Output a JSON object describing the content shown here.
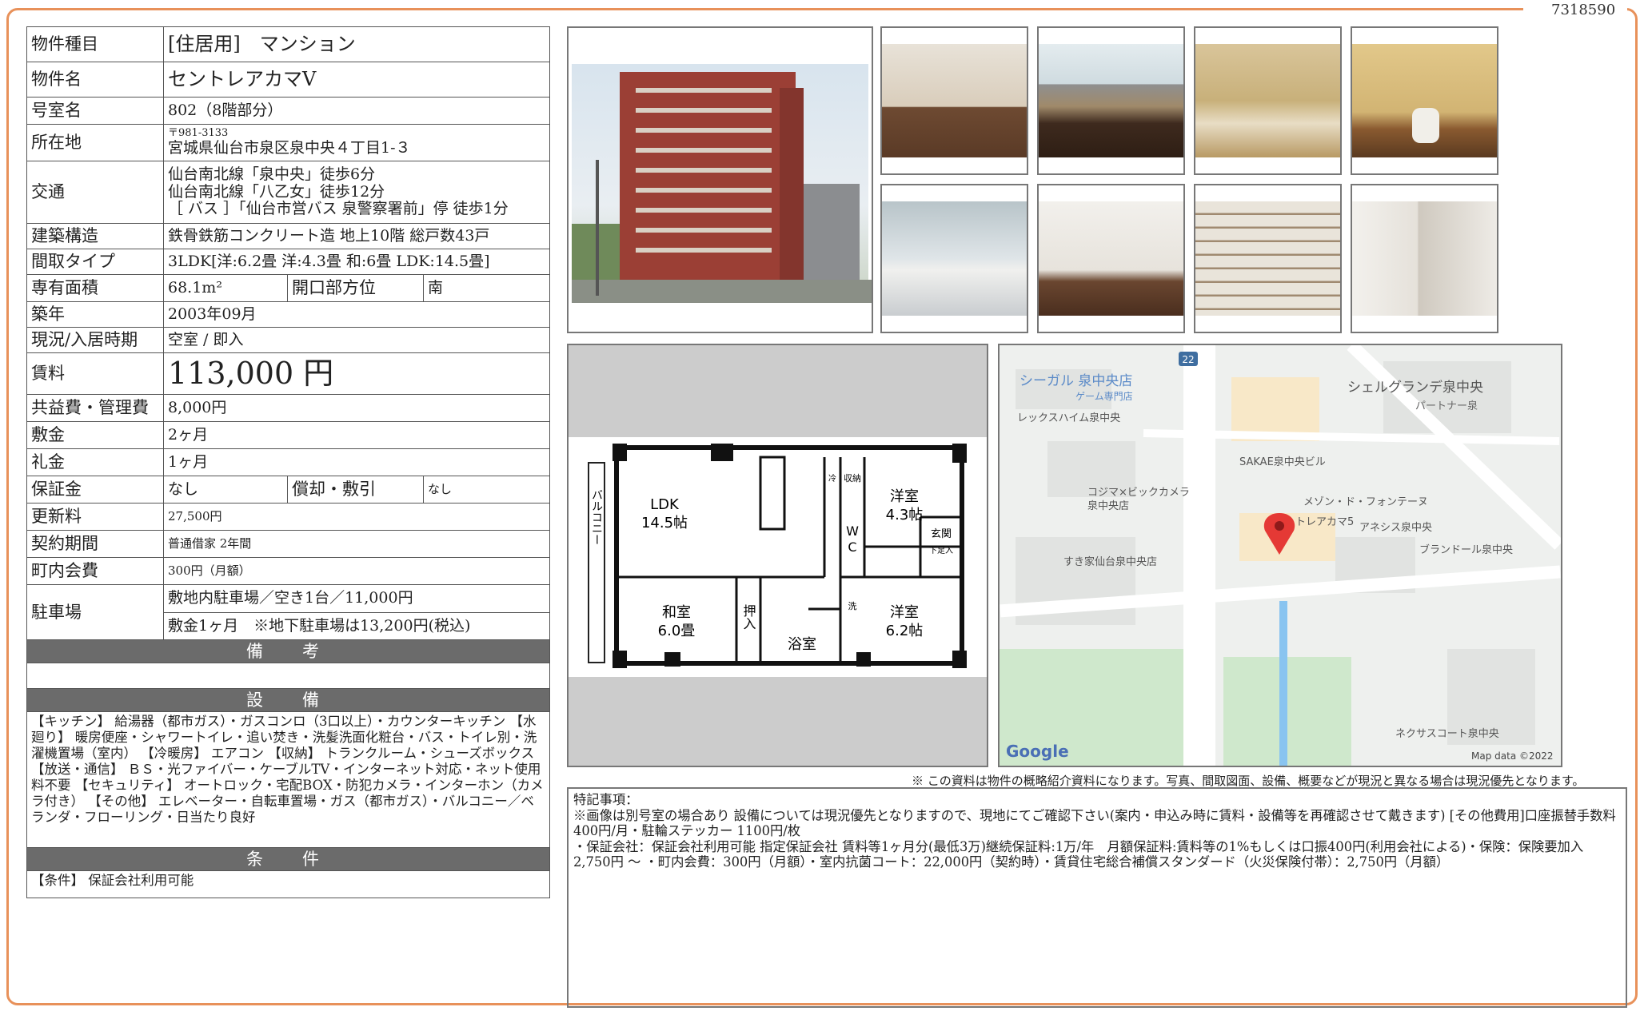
{
  "doc_id": "7318590",
  "property": {
    "type_label": "物件種目",
    "type_value": "[住居用]　マンション",
    "name_label": "物件名",
    "name_value": "セントレアカマV",
    "room_label": "号室名",
    "room_value": "802（8階部分）",
    "address_label": "所在地",
    "postal": "〒981-3133",
    "address": "宮城県仙台市泉区泉中央４丁目1-３",
    "transport_label": "交通",
    "transport_1": "仙台南北線「泉中央」徒歩6分",
    "transport_2": "仙台南北線「八乙女」徒歩12分",
    "transport_3": "［ バス ］「仙台市営バス 泉警察署前」停 徒歩1分",
    "structure_label": "建築構造",
    "structure_value": "鉄骨鉄筋コンクリート造 地上10階 総戸数43戸",
    "layout_label": "間取タイプ",
    "layout_value": "3LDK[洋:6.2畳 洋:4.3畳 和:6畳 LDK:14.5畳]",
    "area_label": "専有面積",
    "area_value": "68.1m²",
    "aspect_label": "開口部方位",
    "aspect_value": "南",
    "built_label": "築年",
    "built_value": "2003年09月",
    "status_label": "現況/入居時期",
    "status_value": "空室 / 即入",
    "rent_label": "賃料",
    "rent_value": "113,000 円",
    "fee_label": "共益費・管理費",
    "fee_value": "8,000円",
    "deposit_label": "敷金",
    "deposit_value": "2ヶ月",
    "keymoney_label": "礼金",
    "keymoney_value": "1ヶ月",
    "guarantee_label": "保証金",
    "guarantee_value": "なし",
    "amort_label": "償却・敷引",
    "amort_value": "なし",
    "renewal_label": "更新料",
    "renewal_value": "27,500円",
    "contract_label": "契約期間",
    "contract_value": "普通借家 2年間",
    "town_label": "町内会費",
    "town_value": "300円（月額）",
    "parking_label": "駐車場",
    "parking_1": "敷地内駐車場／空き1台／11,000円",
    "parking_2": "敷金1ヶ月　※地下駐車場は13,200円(税込)",
    "remarks_header": "備　考",
    "equipment_header": "設　備",
    "equipment_text": "【キッチン】 給湯器（都市ガス）・ガスコンロ（3口以上）・カウンターキッチン 【水廻り】 暖房便座・シャワートイレ・追い焚き・洗髪洗面化粧台・バス・トイレ別・洗濯機置場（室内） 【冷暖房】 エアコン 【収納】 トランクルーム・シューズボックス 【放送・通信】 ＢＳ・光ファイバー・ケーブルTV・インターネット対応・ネット使用料不要 【セキュリティ】 オートロック・宅配BOX・防犯カメラ・インターホン（カメラ付き） 【その他】 エレベーター・自転車置場・ガス（都市ガス）・バルコニー／ベランダ・フローリング・日当たり良好",
    "conditions_header": "条　件",
    "conditions_text": "【条件】 保証会社利用可能"
  },
  "floorplan": {
    "balcony": "バルコニー",
    "ldk_name": "LDK",
    "ldk_size": "14.5帖",
    "west_name": "洋室",
    "west_size": "4.3帖",
    "west2_name": "洋室",
    "west2_size": "6.2帖",
    "wa_name": "和室",
    "wa_size": "6.0畳",
    "oshi": "押入",
    "bath": "浴室",
    "wc1": "W",
    "wc2": "C",
    "storage": "収納",
    "entrance": "玄関",
    "shoes": "下足入",
    "fridge": "冷",
    "wash": "洗"
  },
  "map": {
    "labels": {
      "seagull": "シーガル 泉中央店",
      "game": "ゲーム専門店",
      "shelgrande": "シェルグランデ泉中央",
      "partner": "パートナー泉",
      "lexus": "レックスハイム泉中央",
      "sakae": "SAKAE泉中央ビル",
      "kojima": "コジマ×ビックカメラ",
      "kojima2": "泉中央店",
      "maison": "メゾン・ド・フォンテーヌ",
      "centrea": "トレアカマ5",
      "anesis": "アネシス泉中央",
      "brandor": "ブランドール泉中央",
      "sukiya": "すき家仙台泉中央店",
      "nexus": "ネクサスコート泉中央",
      "route": "22"
    },
    "google": "Google",
    "mapdata": "Map data ©2022"
  },
  "disclaimer": "※ この資料は物件の概略紹介資料になります。写真、間取図面、設備、概要などが現況と異なる場合は現況優先となります。",
  "notes": {
    "title": "特記事項：",
    "line1": "※画像は別号室の場合あり 設備については現況優先となりますので、現地にてご確認下さい(案内・申込み時に賃料・設備等を再確認させて戴きます) [その他費用]口座振替手数料 400円/月・駐輪ステッカー 1100円/枚",
    "line2": "・保証会社：保証会社利用可能 指定保証会社 賃料等1ヶ月分(最低3万)継続保証料:1万/年　月額保証料:賃料等の1%もしくは口振400円(利用会社による)・保険：保険要加入 2,750円 ～ ・町内会費：300円（月額）・室内抗菌コート：22,000円（契約時）・賃貸住宅総合補償スタンダード（火災保険付帯）：2,750円（月額）"
  }
}
